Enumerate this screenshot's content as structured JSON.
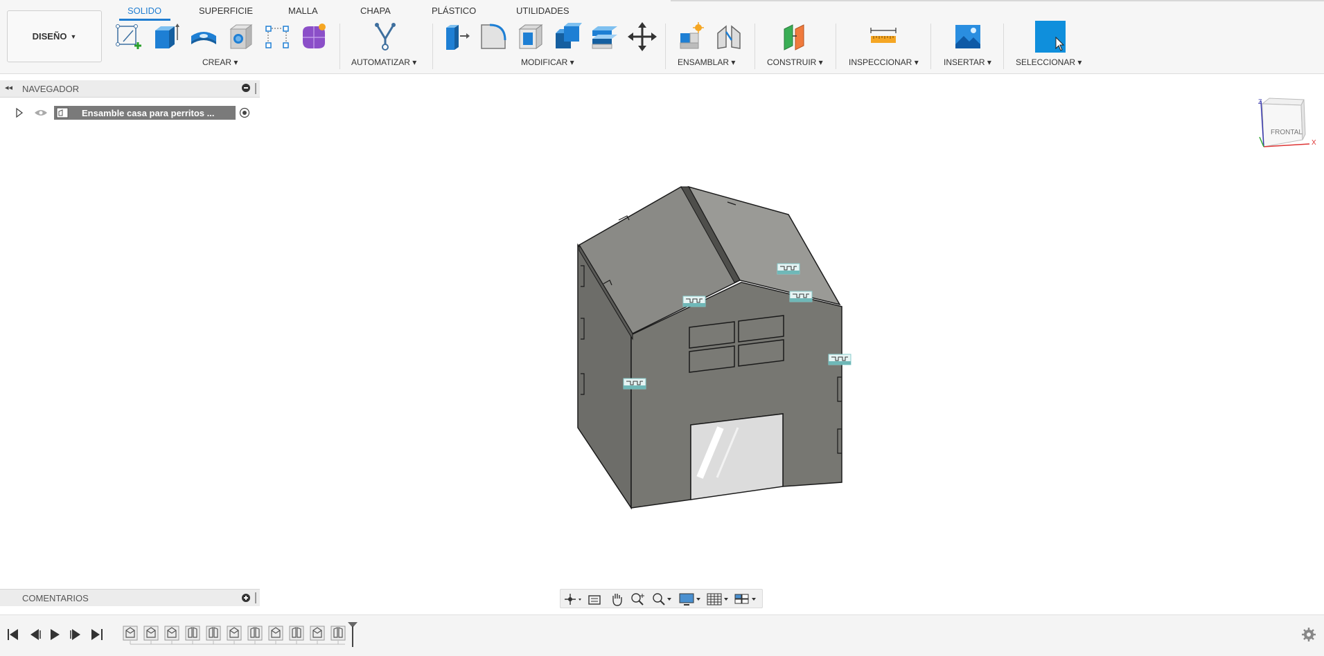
{
  "workspace": {
    "label": "DISEÑO"
  },
  "tabs": [
    {
      "label": "SOLIDO",
      "active": true
    },
    {
      "label": "SUPERFICIE",
      "active": false
    },
    {
      "label": "MALLA",
      "active": false
    },
    {
      "label": "CHAPA",
      "active": false
    },
    {
      "label": "PLÁSTICO",
      "active": false
    },
    {
      "label": "UTILIDADES",
      "active": false
    }
  ],
  "groups": {
    "crear": "CREAR",
    "automatizar": "AUTOMATIZAR",
    "modificar": "MODIFICAR",
    "ensamblar": "ENSAMBLAR",
    "construir": "CONSTRUIR",
    "inspeccionar": "INSPECCIONAR",
    "insertar": "INSERTAR",
    "seleccionar": "SELECCIONAR"
  },
  "tools": {
    "crear": [
      "create-sketch-icon",
      "extrude-icon",
      "revolve-icon",
      "hole-icon",
      "pattern-icon",
      "create-form-icon"
    ],
    "automatizar": [
      "automate-icon"
    ],
    "modificar": [
      "press-pull-icon",
      "fillet-icon",
      "shell-icon",
      "combine-icon",
      "offset-face-icon",
      "move-icon"
    ],
    "ensamblar": [
      "new-component-icon",
      "joint-icon"
    ],
    "construir": [
      "offset-plane-icon"
    ],
    "inspeccionar": [
      "measure-icon"
    ],
    "insertar": [
      "insert-image-icon"
    ],
    "seleccionar": [
      "select-icon"
    ]
  },
  "browser": {
    "title": "NAVEGADOR",
    "root_item": "Ensamble casa para perritos ..."
  },
  "comments": {
    "title": "COMENTARIOS"
  },
  "viewcube": {
    "face_label": "FRONTAL",
    "axis_x": "X",
    "axis_z": "Z"
  },
  "navbar": [
    "orbit-icon",
    "look-at-icon",
    "pan-icon",
    "zoom-icon",
    "fit-icon",
    "display-settings-icon",
    "grid-settings-icon",
    "viewports-icon"
  ],
  "timeline": {
    "controls": [
      "go-to-start-icon",
      "step-back-icon",
      "play-icon",
      "step-forward-icon",
      "go-to-end-icon"
    ],
    "features": [
      "component-icon",
      "component-icon",
      "component-icon",
      "joint-icon",
      "joint-icon",
      "component-icon",
      "joint-icon",
      "component-icon",
      "joint-icon",
      "component-icon",
      "joint-icon"
    ]
  },
  "colors": {
    "accent": "#1f7dd1",
    "model_fill": "#757570",
    "model_roof": "#8c8c88",
    "model_edge": "#1a1a1a"
  }
}
